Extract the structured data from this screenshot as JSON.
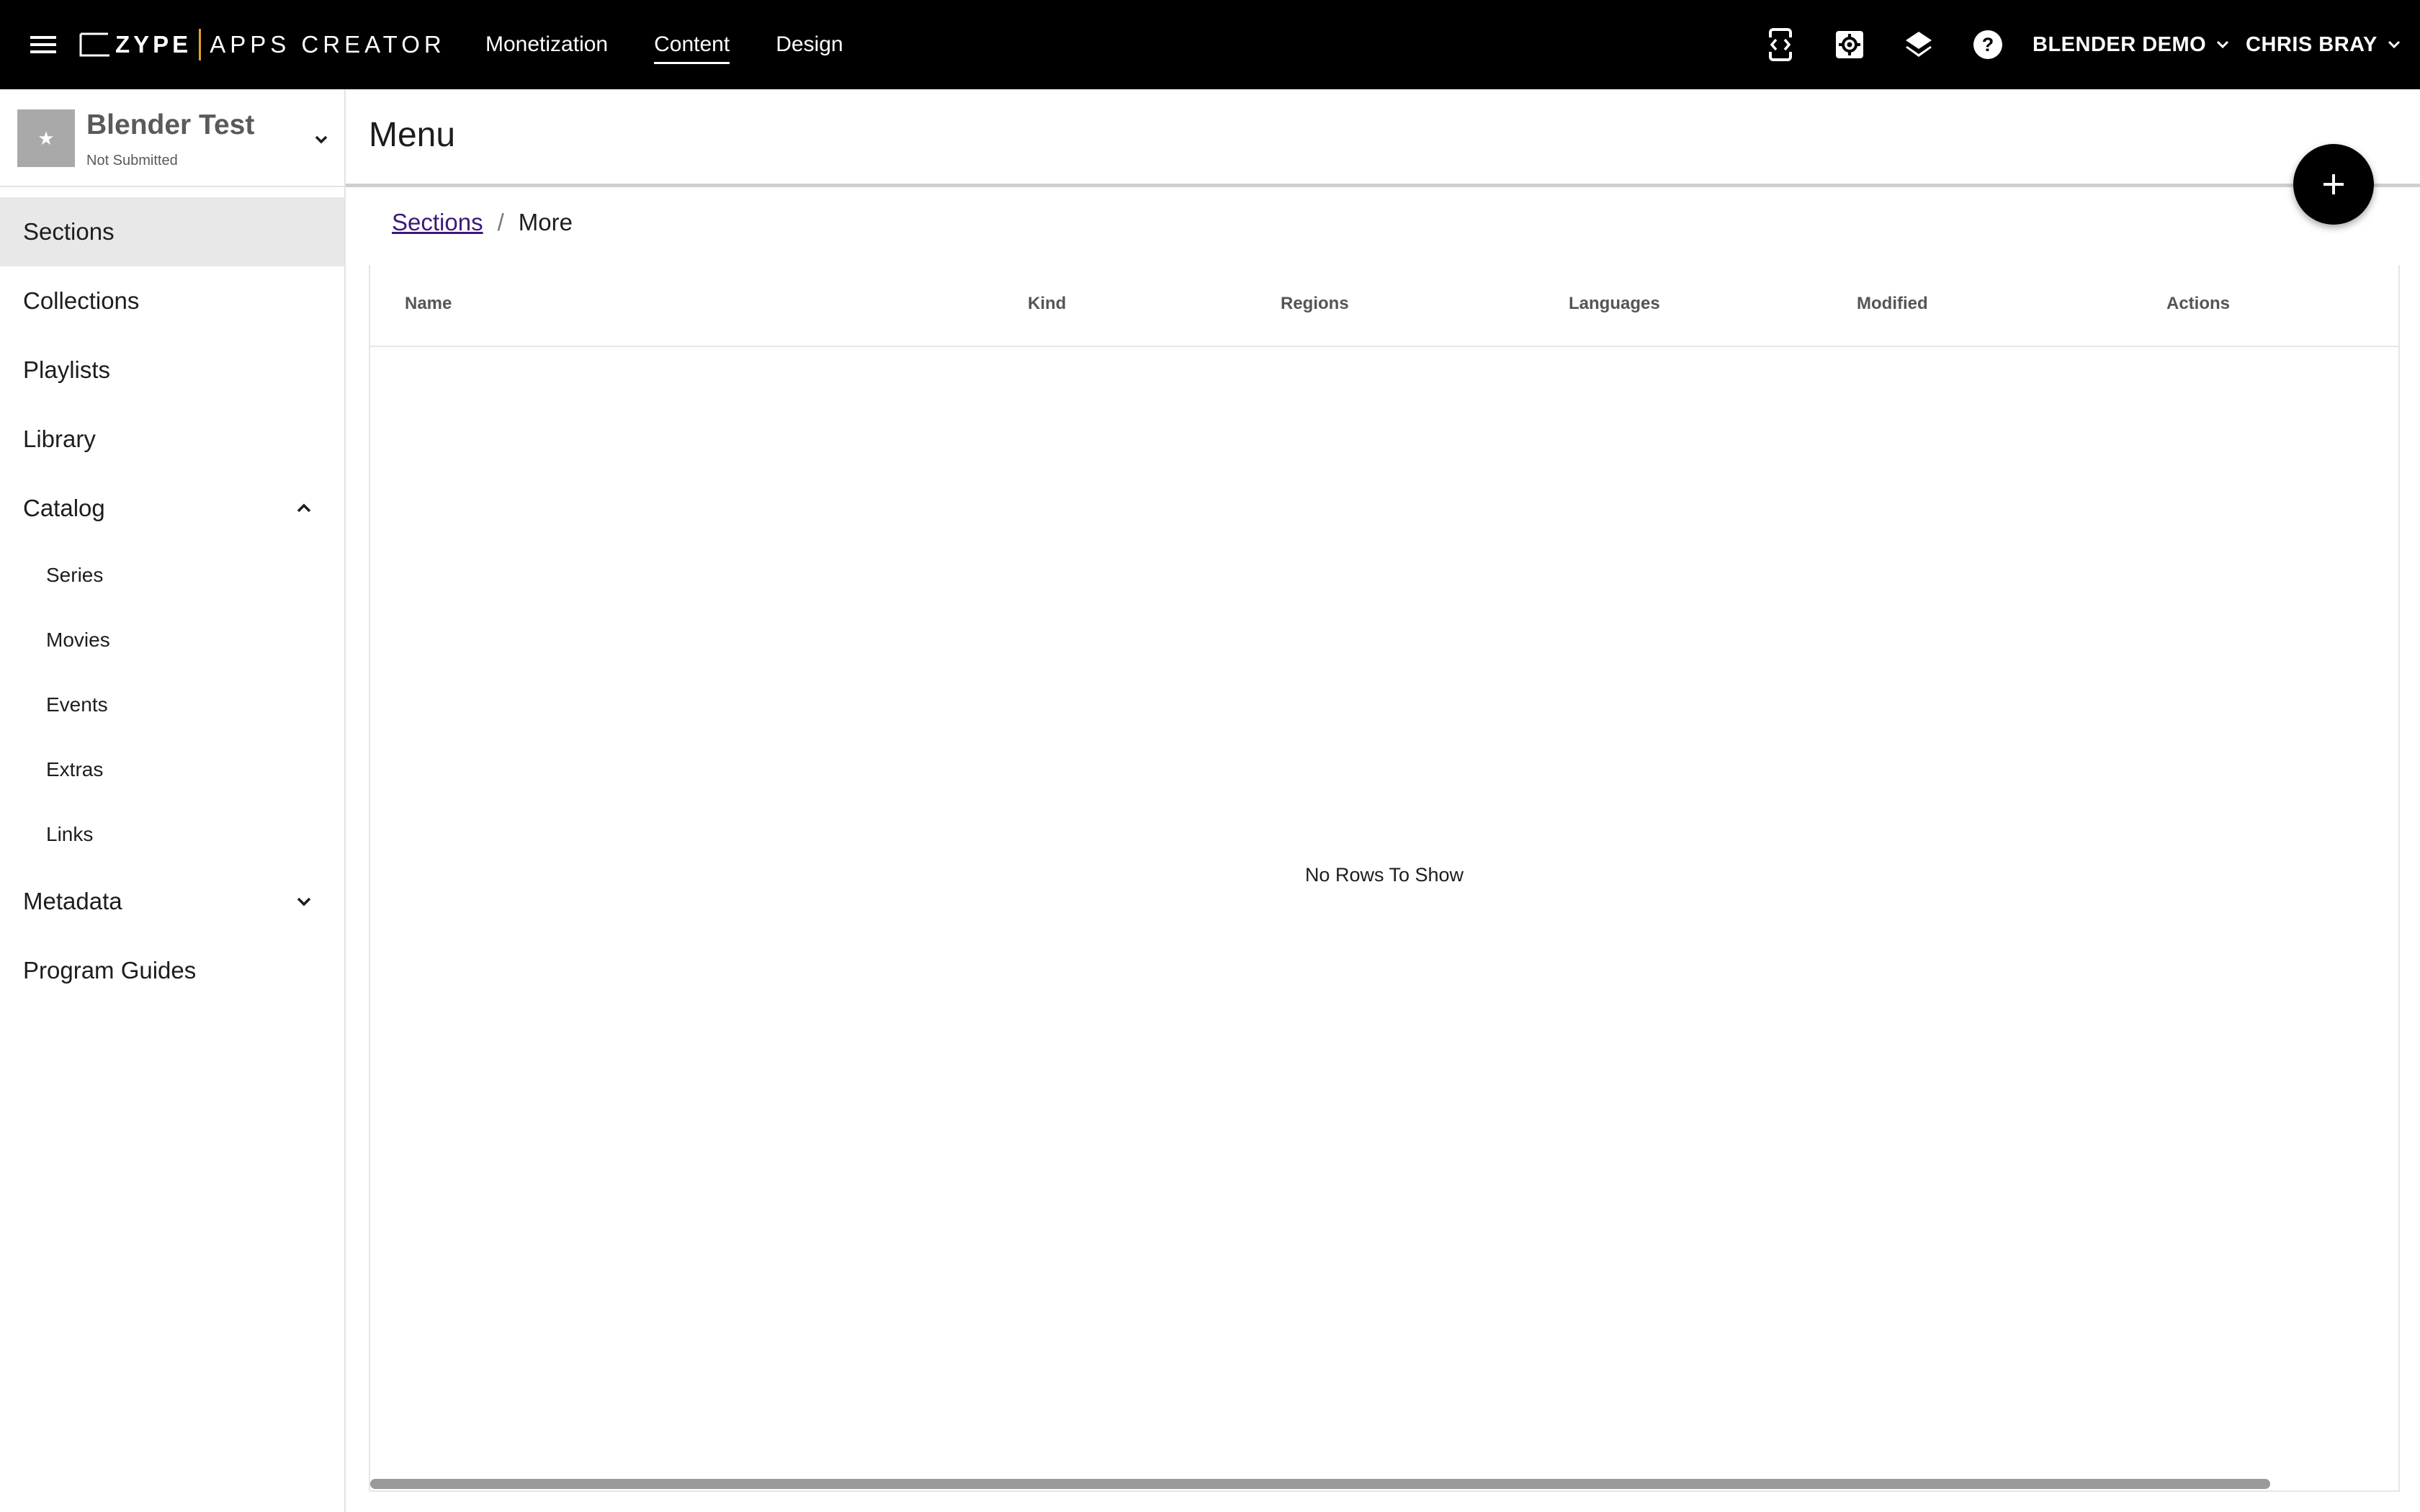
{
  "topbar": {
    "brand": "ZYPE",
    "product": "APPS CREATOR",
    "nav": [
      {
        "label": "Monetization",
        "active": false
      },
      {
        "label": "Content",
        "active": true
      },
      {
        "label": "Design",
        "active": false
      }
    ],
    "icons": [
      "app-preview-icon",
      "settings-icon",
      "layers-icon",
      "help-icon"
    ],
    "account_label": "BLENDER DEMO",
    "user_label": "CHRIS BRAY"
  },
  "sidebar": {
    "app": {
      "name": "Blender Test",
      "status": "Not Submitted",
      "thumb_glyph": "★"
    },
    "items": [
      {
        "label": "Sections",
        "active": true
      },
      {
        "label": "Collections"
      },
      {
        "label": "Playlists"
      },
      {
        "label": "Library"
      },
      {
        "label": "Catalog",
        "expanded": true
      },
      {
        "label": "Series"
      },
      {
        "label": "Movies"
      },
      {
        "label": "Events"
      },
      {
        "label": "Extras"
      },
      {
        "label": "Links"
      },
      {
        "label": "Metadata",
        "expanded": false
      },
      {
        "label": "Program Guides"
      }
    ]
  },
  "main": {
    "title": "Menu",
    "breadcrumb": {
      "parent": "Sections",
      "separator": "/",
      "current": "More"
    },
    "table": {
      "columns": [
        "Name",
        "Kind",
        "Regions",
        "Languages",
        "Modified",
        "Actions"
      ],
      "empty_message": "No Rows To Show"
    }
  },
  "colors": {
    "topbar": "#000000",
    "active_item": "#e8e8e8",
    "link": "#3b1a7a",
    "logo_divider": "#e0a32b"
  }
}
